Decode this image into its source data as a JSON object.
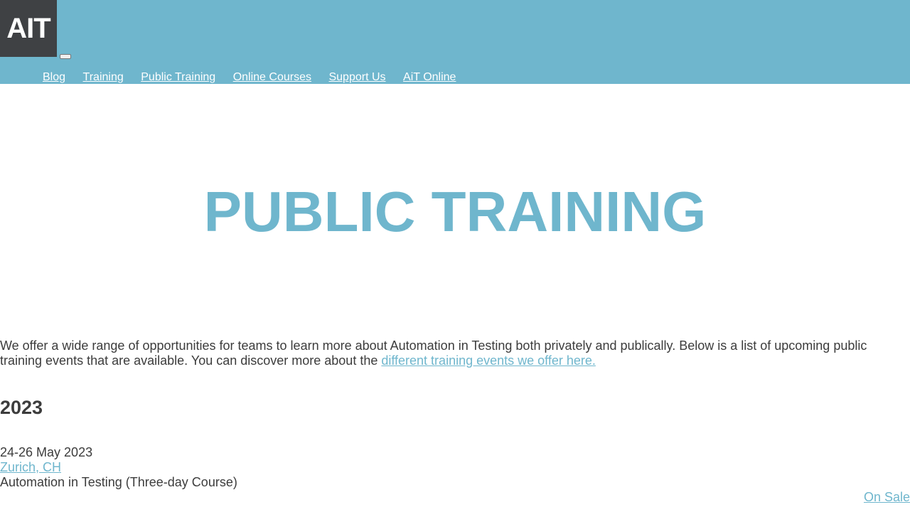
{
  "header": {
    "logo_text": "AIT",
    "nav": [
      {
        "label": "Blog"
      },
      {
        "label": "Training"
      },
      {
        "label": "Public Training"
      },
      {
        "label": "Online Courses"
      },
      {
        "label": "Support Us"
      },
      {
        "label": "AiT Online"
      }
    ]
  },
  "hero": {
    "title": "PUBLIC TRAINING"
  },
  "intro": {
    "text": "We offer a wide range of opportunities for teams to learn more about Automation in Testing both privately and publically. Below is a list of upcoming public training events that are available. You can discover more about the ",
    "link_label": "different training events we offer here."
  },
  "events": {
    "year": "2023",
    "items": [
      {
        "date": "24-26 May 2023",
        "location": "Zurich, CH",
        "course": "Automation in Testing (Three-day Course)",
        "status": "On Sale"
      }
    ]
  },
  "colors": {
    "accent": "#6fb6cd",
    "logo_bg": "#3f4144",
    "text": "#3c3c3c"
  }
}
